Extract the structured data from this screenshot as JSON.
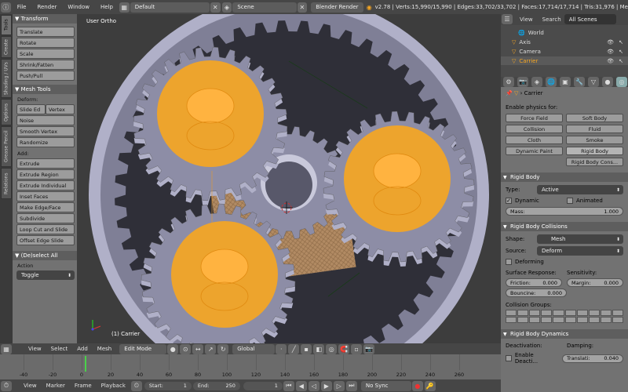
{
  "topbar": {
    "menus": [
      "File",
      "Render",
      "Window",
      "Help"
    ],
    "layout": "Default",
    "scene": "Scene",
    "engine": "Blender Render",
    "stats": "v2.78 | Verts:15,990/15,990 | Edges:33,702/33,702 | Faces:17,714/17,714 | Tris:31,976 | Me"
  },
  "left_tabs": [
    "Tools",
    "Create",
    "Shading / UVs",
    "Options",
    "Grease Pencil",
    "Relations"
  ],
  "tool_shelf": {
    "transform": {
      "header": "Transform",
      "buttons": [
        "Translate",
        "Rotate",
        "Scale",
        "Shrink/Fatten",
        "Push/Pull"
      ]
    },
    "mesh_tools": {
      "header": "Mesh Tools",
      "deform_label": "Deform:",
      "slide_edge": "Slide Ed",
      "vertex": "Vertex",
      "deform_buttons": [
        "Noise",
        "Smooth Vertex",
        "Randomize"
      ],
      "add_label": "Add:",
      "add_buttons": [
        "Extrude",
        "Extrude Region",
        "Extrude Individual",
        "Inset Faces",
        "Make Edge/Face",
        "Subdivide",
        "Loop Cut and Slide",
        "Offset Edge Slide"
      ]
    },
    "operator": {
      "header": "(De)select All",
      "action_label": "Action",
      "action_value": "Toggle"
    }
  },
  "viewport": {
    "view_label": "User Ortho",
    "object_label": "(1) Carrier"
  },
  "outliner": {
    "view": "View",
    "search": "Search",
    "scope": "All Scenes",
    "items": [
      "World",
      "Axis",
      "Camera",
      "Carrier"
    ]
  },
  "properties": {
    "object": "Carrier",
    "physics_label": "Enable physics for:",
    "physics_buttons": [
      "Force Field",
      "Soft Body",
      "Collision",
      "Fluid",
      "Cloth",
      "Smoke",
      "Dynamic Paint",
      "Rigid Body",
      "Rigid Body Cons..."
    ],
    "rigid_body": {
      "header": "Rigid Body",
      "type_label": "Type:",
      "type_value": "Active",
      "dynamic": "Dynamic",
      "animated": "Animated",
      "mass_label": "Mass:",
      "mass_value": "1.000"
    },
    "collisions": {
      "header": "Rigid Body Collisions",
      "shape_label": "Shape:",
      "shape_value": "Mesh",
      "source_label": "Source:",
      "source_value": "Deform",
      "deforming": "Deforming",
      "surface_label": "Surface Response:",
      "sensitivity_label": "Sensitivity:",
      "friction_label": "Friction:",
      "friction_value": "0.000",
      "margin_label": "Margin:",
      "margin_value": "0.000",
      "bounciness_label": "Bouncine:",
      "bounciness_value": "0.000",
      "groups_label": "Collision Groups:"
    },
    "dynamics": {
      "header": "Rigid Body Dynamics",
      "deactivation_label": "Deactivation:",
      "damping_label": "Damping:",
      "enable_deactivation": "Enable Deacti...",
      "translation_label": "Translati:",
      "translation_value": "0.040"
    }
  },
  "view3d_header": {
    "menus": [
      "View",
      "Select",
      "Add",
      "Mesh"
    ],
    "mode": "Edit Mode",
    "orientation": "Global"
  },
  "timeline": {
    "ruler": [
      "-40",
      "-20",
      "0",
      "20",
      "40",
      "60",
      "80",
      "100",
      "120",
      "140",
      "160",
      "180",
      "200",
      "220",
      "240",
      "260"
    ],
    "menus": [
      "View",
      "Marker",
      "Frame",
      "Playback"
    ],
    "start_label": "Start:",
    "start_value": "1",
    "end_label": "End:",
    "end_value": "250",
    "current_frame": "1",
    "sync": "No Sync"
  },
  "colors": {
    "accent_orange": "#f5a623",
    "gear_face": "#8d8da6",
    "gear_side": "#b0b0c8",
    "panel_bg": "#727272",
    "header_bg": "#464646"
  }
}
